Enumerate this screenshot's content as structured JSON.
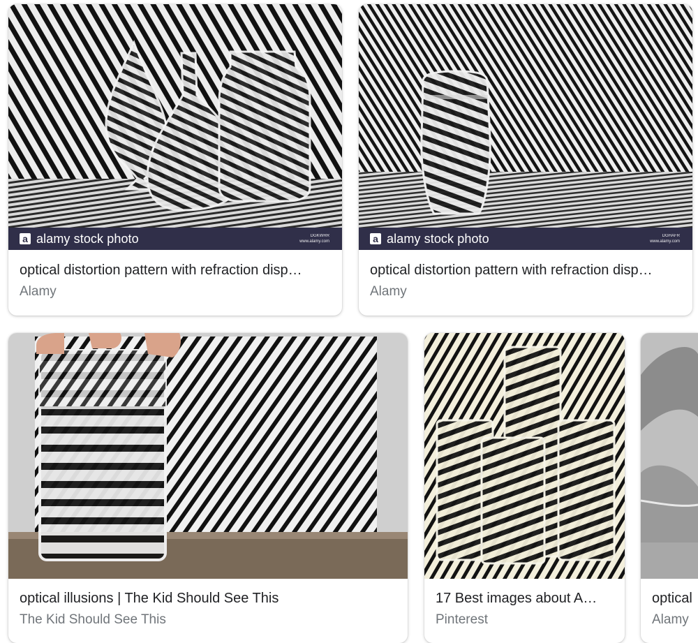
{
  "cards": [
    {
      "title": "optical distortion pattern with refraction disp…",
      "source": "Alamy",
      "image_alt": "Glass vases in front of diagonal black and white stripes",
      "watermark": {
        "logo": "a",
        "text": "alamy stock photo",
        "code": "DGKWRR",
        "url": "www.alamy.com"
      }
    },
    {
      "title": "optical distortion pattern with refraction disp…",
      "source": "Alamy",
      "image_alt": "Glass of water in front of diagonal black and white stripes",
      "watermark": {
        "logo": "a",
        "text": "alamy stock photo",
        "code": "DGHAFR",
        "url": "www.alamy.com"
      }
    },
    {
      "title": "optical illusions | The Kid Should See This",
      "source": "The Kid Should See This",
      "image_alt": "Hands holding a glass of water in front of a striped card"
    },
    {
      "title": "17 Best images about A…",
      "source": "Pinterest",
      "image_alt": "Several glasses refracting a striped background"
    },
    {
      "title": "optical",
      "source": "Alamy",
      "image_alt": "Partially visible glass image"
    }
  ]
}
